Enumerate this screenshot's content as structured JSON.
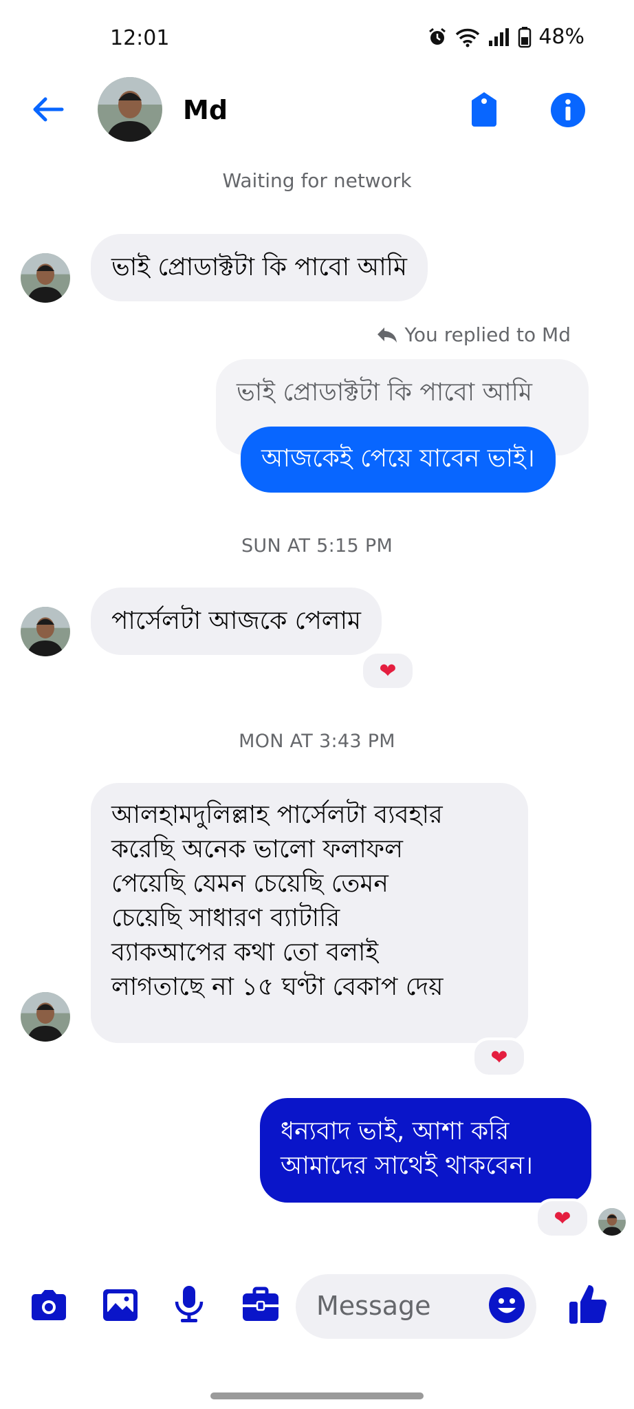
{
  "status_bar": {
    "time": "12:01",
    "battery": "48%",
    "icons": [
      "alarm-icon",
      "wifi-icon",
      "signal-icon",
      "battery-icon"
    ]
  },
  "header": {
    "contact_name": "Md",
    "icons": [
      "back-arrow-icon",
      "tag-icon",
      "info-icon"
    ]
  },
  "network_status": "Waiting for network",
  "messages": {
    "m1": "ভাই প্রোডাক্টটা কি পাবো আমি",
    "reply_note": "You replied to Md",
    "quoted": "ভাই প্রোডাক্টটা কি পাবো আমি",
    "m2": "আজকেই পেয়ে যাবেন ভাই।",
    "ts1": "SUN AT 5:15 PM",
    "m3": "পার্সেলটা আজকে পেলাম",
    "ts2": "MON AT 3:43 PM",
    "m4_lines": [
      "আলহামদুলিল্লাহ পার্সেলটা ব্যবহার",
      "করেছি অনেক ভালো ফলাফল",
      "পেয়েছি যেমন চেয়েছি তেমন",
      "চেয়েছি সাধারণ ব্যাটারি",
      "ব্যাকআপের কথা তো বলাই",
      "লাগতাছে না ১৫ ঘণ্টা বেকাপ দেয়"
    ],
    "m5_lines": [
      "ধন্যবাদ ভাই, আশা করি",
      "আমাদের সাথেই থাকবেন।"
    ]
  },
  "reactions": {
    "heart": "❤"
  },
  "composer": {
    "placeholder": "Message",
    "icons": [
      "camera-icon",
      "image-icon",
      "microphone-icon",
      "briefcase-icon",
      "emoji-icon",
      "thumbs-up-icon"
    ]
  },
  "colors": {
    "accent": "#0866ff",
    "accent_dark": "#0a15c9",
    "bubble_in": "#f0f0f4",
    "muted_text": "#65676b",
    "heart": "#e41e3f"
  }
}
